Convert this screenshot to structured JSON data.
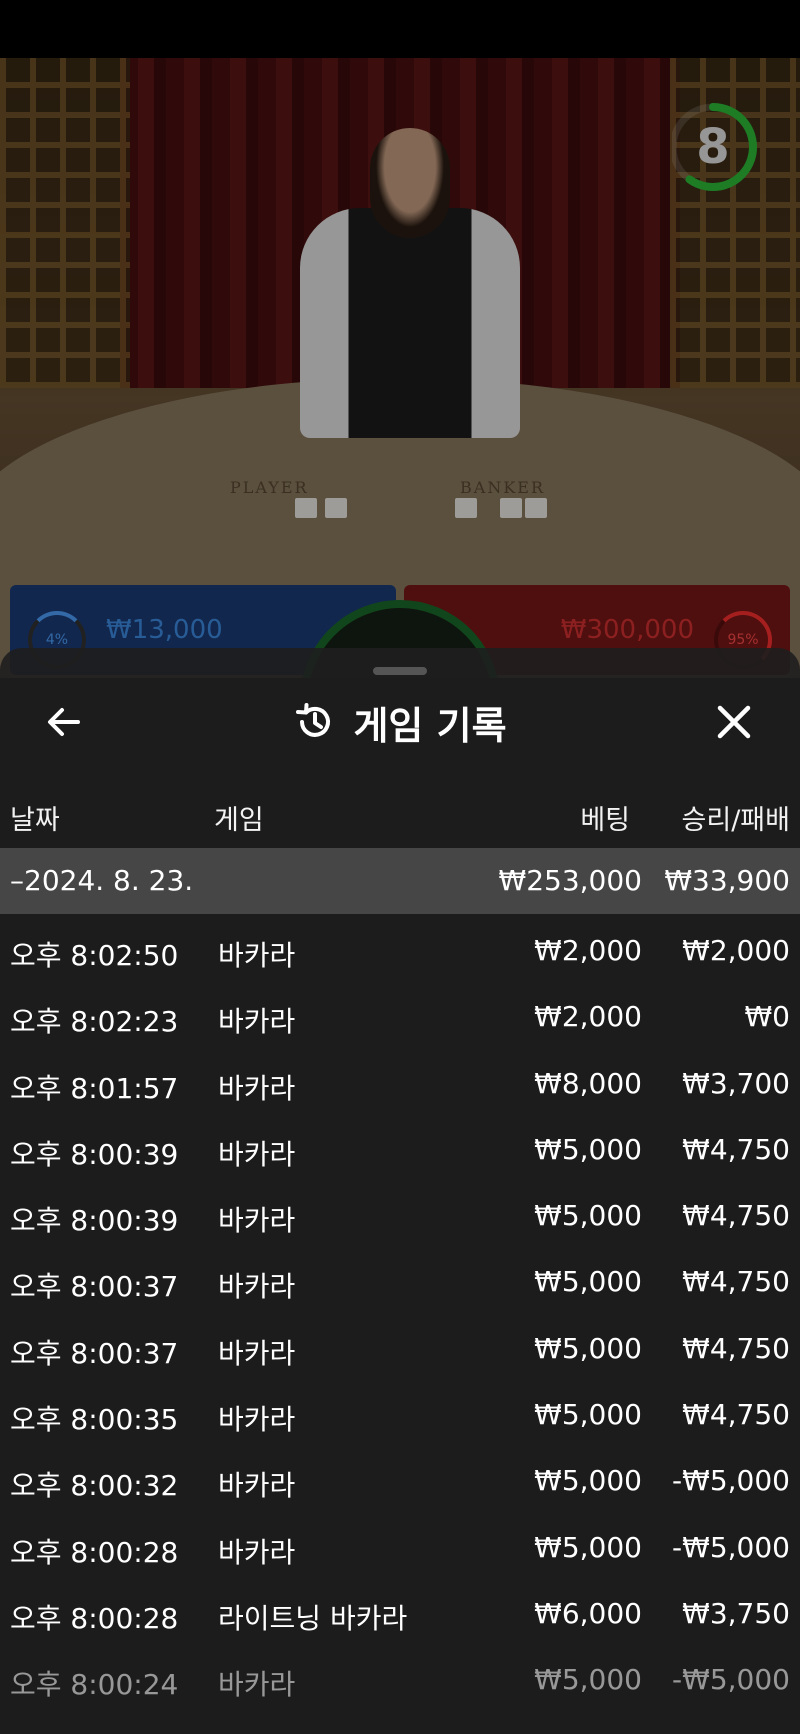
{
  "video": {
    "countdown": "8",
    "countdown_fraction": 0.6,
    "felt_labels": [
      "PLAYER",
      "BANKER"
    ]
  },
  "bets": {
    "player_amount": "₩13,000",
    "player_pct": "4%",
    "banker_amount": "₩300,000",
    "banker_pct": "95%",
    "player_color": "#1d3d78",
    "banker_color": "#7a1717"
  },
  "sheet": {
    "title": "게임 기록",
    "back_icon": "arrow-left-icon",
    "history_icon": "history-clock-icon",
    "close_icon": "close-icon",
    "columns": {
      "date": "날짜",
      "game": "게임",
      "bet": "베팅",
      "result": "승리/패배"
    },
    "date_group": {
      "date": "–2024. 8. 23.",
      "bet_total": "₩253,000",
      "result_total": "₩33,900"
    },
    "rows": [
      {
        "time": "오후 8:02:50",
        "game": "바카라",
        "bet": "₩2,000",
        "result": "₩2,000"
      },
      {
        "time": "오후 8:02:23",
        "game": "바카라",
        "bet": "₩2,000",
        "result": "₩0"
      },
      {
        "time": "오후 8:01:57",
        "game": "바카라",
        "bet": "₩8,000",
        "result": "₩3,700"
      },
      {
        "time": "오후 8:00:39",
        "game": "바카라",
        "bet": "₩5,000",
        "result": "₩4,750"
      },
      {
        "time": "오후 8:00:39",
        "game": "바카라",
        "bet": "₩5,000",
        "result": "₩4,750"
      },
      {
        "time": "오후 8:00:37",
        "game": "바카라",
        "bet": "₩5,000",
        "result": "₩4,750"
      },
      {
        "time": "오후 8:00:37",
        "game": "바카라",
        "bet": "₩5,000",
        "result": "₩4,750"
      },
      {
        "time": "오후 8:00:35",
        "game": "바카라",
        "bet": "₩5,000",
        "result": "₩4,750"
      },
      {
        "time": "오후 8:00:32",
        "game": "바카라",
        "bet": "₩5,000",
        "result": "-₩5,000"
      },
      {
        "time": "오후 8:00:28",
        "game": "바카라",
        "bet": "₩5,000",
        "result": "-₩5,000"
      },
      {
        "time": "오후 8:00:28",
        "game": "라이트닝 바카라",
        "bet": "₩6,000",
        "result": "₩3,750"
      },
      {
        "time": "오후 8:00:24",
        "game": "바카라",
        "bet": "₩5,000",
        "result": "-₩5,000"
      }
    ]
  }
}
